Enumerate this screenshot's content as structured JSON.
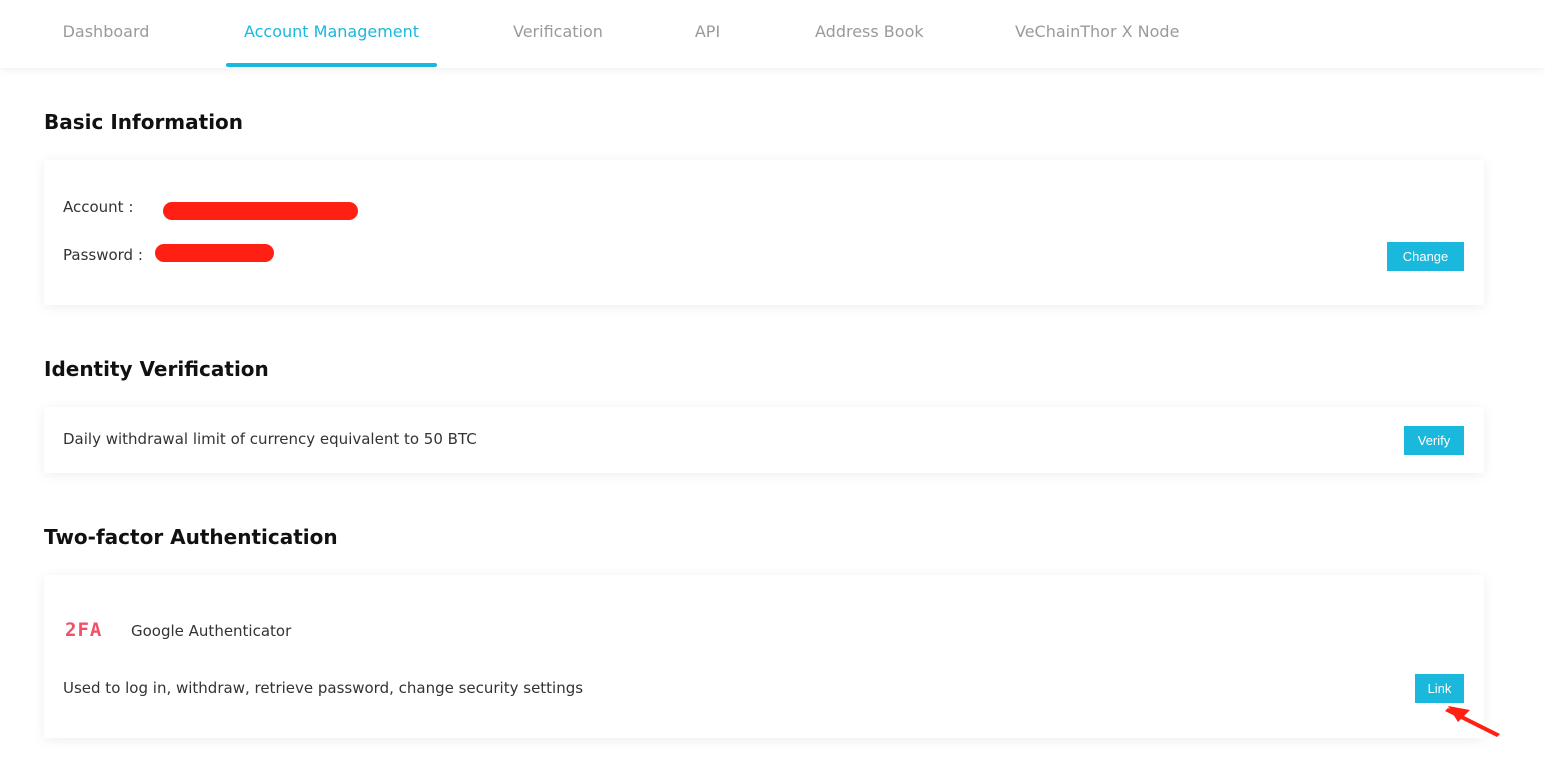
{
  "tabs": [
    {
      "label": "Dashboard"
    },
    {
      "label": "Account Management"
    },
    {
      "label": "Verification"
    },
    {
      "label": "API"
    },
    {
      "label": "Address Book"
    },
    {
      "label": "VeChainThor X Node"
    }
  ],
  "active_tab": "Account Management",
  "basic_info": {
    "title": "Basic Information",
    "account_label": "Account :",
    "password_label": "Password :",
    "change_button": "Change"
  },
  "identity": {
    "title": "Identity Verification",
    "description": "Daily withdrawal limit of currency equivalent to 50 BTC",
    "verify_button": "Verify"
  },
  "two_factor": {
    "title": "Two-factor Authentication",
    "icon_text": "2FA",
    "method_name": "Google Authenticator",
    "description": "Used to log in, withdraw, retrieve password, change security settings",
    "link_button": "Link"
  },
  "colors": {
    "accent": "#19b8dc",
    "redaction": "#ff1f13",
    "twofa_icon": "#f2506a",
    "annotation_arrow": "#ff1f13"
  }
}
